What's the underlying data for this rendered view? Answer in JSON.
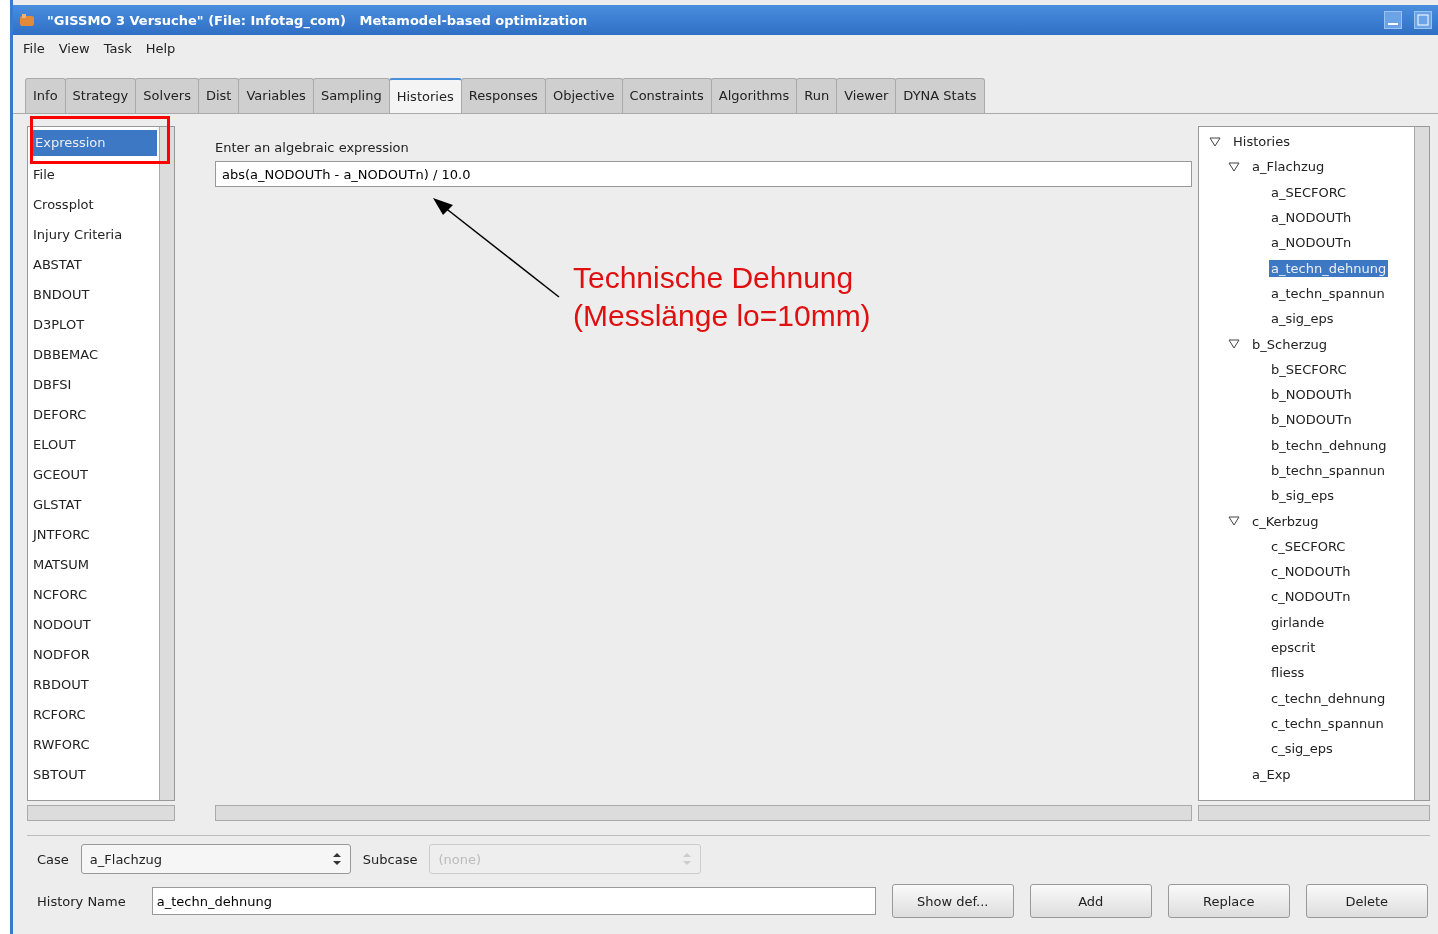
{
  "window": {
    "title": "\"GISSMO 3 Versuche\" (File: Infotag_com)   Metamodel-based optimization"
  },
  "menu": [
    "File",
    "View",
    "Task",
    "Help"
  ],
  "tabs": [
    {
      "label": "Info",
      "selected": false
    },
    {
      "label": "Strategy",
      "selected": false
    },
    {
      "label": "Solvers",
      "selected": false
    },
    {
      "label": "Dist",
      "selected": false
    },
    {
      "label": "Variables",
      "selected": false
    },
    {
      "label": "Sampling",
      "selected": false
    },
    {
      "label": "Histories",
      "selected": true
    },
    {
      "label": "Responses",
      "selected": false
    },
    {
      "label": "Objective",
      "selected": false
    },
    {
      "label": "Constraints",
      "selected": false
    },
    {
      "label": "Algorithms",
      "selected": false
    },
    {
      "label": "Run",
      "selected": false
    },
    {
      "label": "Viewer",
      "selected": false
    },
    {
      "label": "DYNA Stats",
      "selected": false
    }
  ],
  "categories": [
    {
      "label": "Expression",
      "selected": true
    },
    {
      "label": "File",
      "selected": false
    },
    {
      "label": "Crossplot",
      "selected": false
    },
    {
      "label": "Injury Criteria",
      "selected": false
    },
    {
      "label": "ABSTAT",
      "selected": false
    },
    {
      "label": "BNDOUT",
      "selected": false
    },
    {
      "label": "D3PLOT",
      "selected": false
    },
    {
      "label": "DBBEMAC",
      "selected": false
    },
    {
      "label": "DBFSI",
      "selected": false
    },
    {
      "label": "DEFORC",
      "selected": false
    },
    {
      "label": "ELOUT",
      "selected": false
    },
    {
      "label": "GCEOUT",
      "selected": false
    },
    {
      "label": "GLSTAT",
      "selected": false
    },
    {
      "label": "JNTFORC",
      "selected": false
    },
    {
      "label": "MATSUM",
      "selected": false
    },
    {
      "label": "NCFORC",
      "selected": false
    },
    {
      "label": "NODOUT",
      "selected": false
    },
    {
      "label": "NODFOR",
      "selected": false
    },
    {
      "label": "RBDOUT",
      "selected": false
    },
    {
      "label": "RCFORC",
      "selected": false
    },
    {
      "label": "RWFORC",
      "selected": false
    },
    {
      "label": "SBTOUT",
      "selected": false
    }
  ],
  "expression": {
    "label": "Enter an algebraic expression",
    "value": "abs(a_NODOUTh - a_NODOUTn) / 10.0"
  },
  "annotation": {
    "lines": [
      "Technische Dehnung",
      "(Messlänge lo=10mm)"
    ]
  },
  "tree": {
    "label": "Histories",
    "expanded": true,
    "selected": false,
    "children": [
      {
        "label": "a_Flachzug",
        "expanded": true,
        "selected": false,
        "children": [
          {
            "label": "a_SECFORC",
            "selected": false
          },
          {
            "label": "a_NODOUTh",
            "selected": false
          },
          {
            "label": "a_NODOUTn",
            "selected": false
          },
          {
            "label": "a_techn_dehnung",
            "selected": true
          },
          {
            "label": "a_techn_spannun",
            "selected": false
          },
          {
            "label": "a_sig_eps",
            "selected": false
          }
        ]
      },
      {
        "label": "b_Scherzug",
        "expanded": true,
        "selected": false,
        "children": [
          {
            "label": "b_SECFORC",
            "selected": false
          },
          {
            "label": "b_NODOUTh",
            "selected": false
          },
          {
            "label": "b_NODOUTn",
            "selected": false
          },
          {
            "label": "b_techn_dehnung",
            "selected": false
          },
          {
            "label": "b_techn_spannun",
            "selected": false
          },
          {
            "label": "b_sig_eps",
            "selected": false
          }
        ]
      },
      {
        "label": "c_Kerbzug",
        "expanded": true,
        "selected": false,
        "children": [
          {
            "label": "c_SECFORC",
            "selected": false
          },
          {
            "label": "c_NODOUTh",
            "selected": false
          },
          {
            "label": "c_NODOUTn",
            "selected": false
          },
          {
            "label": "girlande",
            "selected": false
          },
          {
            "label": "epscrit",
            "selected": false
          },
          {
            "label": "fliess",
            "selected": false
          },
          {
            "label": "c_techn_dehnung",
            "selected": false
          },
          {
            "label": "c_techn_spannun",
            "selected": false
          },
          {
            "label": "c_sig_eps",
            "selected": false
          }
        ]
      },
      {
        "label": "a_Exp",
        "selected": false
      }
    ]
  },
  "case": {
    "label": "Case",
    "value": "a_Flachzug"
  },
  "subcase": {
    "label": "Subcase",
    "value": "(none)",
    "disabled": true
  },
  "history_name": {
    "label": "History Name",
    "value": "a_techn_dehnung"
  },
  "buttons": [
    "Show def...",
    "Add",
    "Replace",
    "Delete"
  ]
}
